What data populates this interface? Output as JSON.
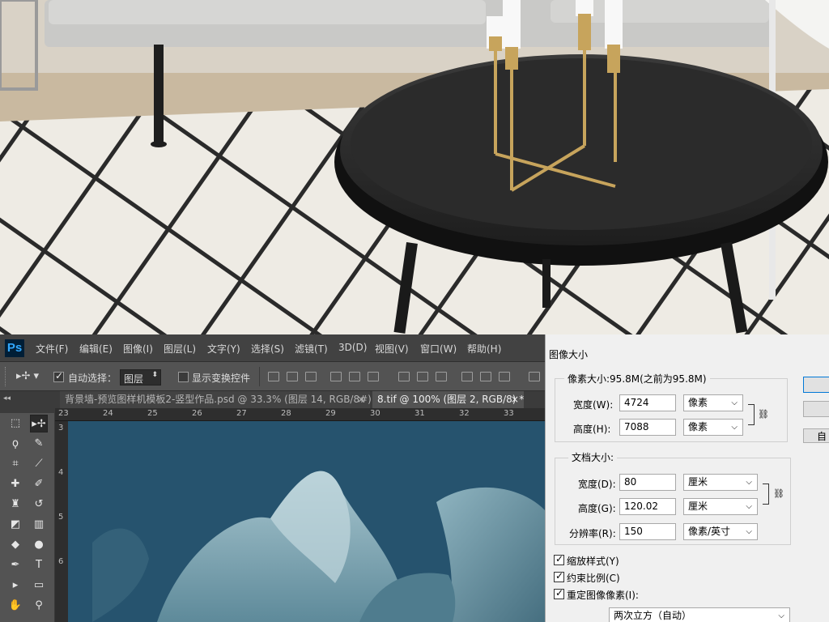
{
  "photoshop": {
    "logo": "Ps",
    "menu": [
      "文件(F)",
      "编辑(E)",
      "图像(I)",
      "图层(L)",
      "文字(Y)",
      "选择(S)",
      "滤镜(T)",
      "3D(D)",
      "视图(V)",
      "窗口(W)",
      "帮助(H)"
    ],
    "options": {
      "auto_select_label": "自动选择：",
      "auto_select_value": "图层",
      "show_transform_label": "显示变换控件"
    },
    "tabs": [
      {
        "label": "背景墙-预览图样机模板2-竖型作品.psd @ 33.3% (图层 14, RGB/8#)",
        "close": "×"
      },
      {
        "label": "8.tif @ 100% (图层 2, RGB/8) *",
        "close": "×"
      }
    ],
    "collapse_glyph": "◂◂",
    "ruler_top": [
      "23",
      "24",
      "25",
      "26",
      "27",
      "28",
      "29",
      "30",
      "31",
      "32",
      "33"
    ],
    "ruler_left": [
      "3",
      "4",
      "5",
      "6"
    ]
  },
  "dialog": {
    "title": "图像大小",
    "pixel_size": "像素大小:95.8M(之前为95.8M)",
    "width_label": "宽度(W):",
    "width_value": "4724",
    "width_unit": "像素",
    "height_label": "高度(H):",
    "height_value": "7088",
    "height_unit": "像素",
    "doc_size": "文档大小:",
    "doc_width_label": "宽度(D):",
    "doc_width_value": "80",
    "doc_width_unit": "厘米",
    "doc_height_label": "高度(G):",
    "doc_height_value": "120.02",
    "doc_height_unit": "厘米",
    "resolution_label": "分辨率(R):",
    "resolution_value": "150",
    "resolution_unit": "像素/英寸",
    "scale_styles": "缩放样式(Y)",
    "constrain": "约束比例(C)",
    "resample": "重定图像像素(I):",
    "resample_method": "两次立方（自动）",
    "auto_button": "自动"
  }
}
